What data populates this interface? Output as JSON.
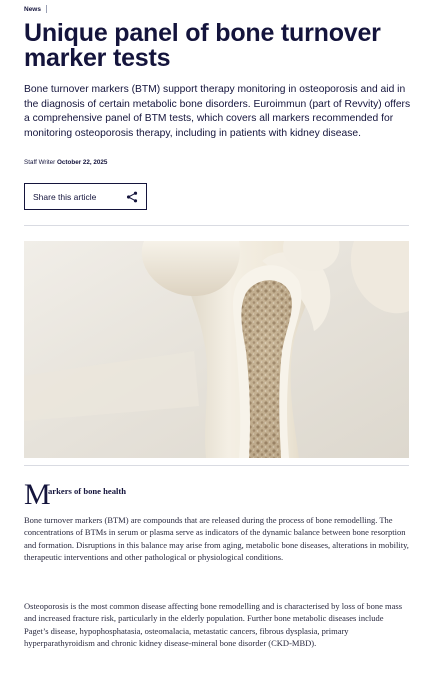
{
  "breadcrumb": {
    "category": "News"
  },
  "article": {
    "title": "Unique panel of bone turnover marker tests",
    "lead": "Bone turnover markers (BTM) support therapy monitoring in osteoporosis and aid in the diagnosis of certain metabolic bone disorders. Euroimmun (part of Revvity) offers a comprehensive panel of BTM tests, which covers all markers recommended for monitoring osteoporosis therapy, including in patients with kidney disease.",
    "author": "Staff Writer",
    "date": "October 22, 2025"
  },
  "share": {
    "label": "Share this article",
    "icon": "share-icon"
  },
  "section": {
    "dropcap": "M",
    "title": "arkers of bone health",
    "paragraphs": [
      "Bone turnover markers (BTM) are compounds that are released during the process of bone remodelling. The concentrations of BTMs in serum or plasma serve as indicators of the dynamic balance between bone resorption and formation. Disruptions in this balance may arise from aging, metabolic bone diseases, alterations in mobility, therapeutic interventions and other pathological or physiological conditions.",
      "Osteoporosis is the most common disease affecting bone remodelling and is characterised by loss of bone mass and increased fracture risk, particularly in the elderly population. Further bone metabolic diseases include Paget’s disease, hypophosphatasia, osteomalacia, metastatic cancers, fibrous dysplasia, primary hyperparathyroidism and chronic kidney disease-mineral bone disorder (CKD-MBD)."
    ]
  },
  "colors": {
    "text": "#14143c",
    "divider": "#d9dbe2",
    "image_bg": "#e8e4dc",
    "bone": "#efe9dc",
    "bone_marrow": "#b8a58a"
  }
}
